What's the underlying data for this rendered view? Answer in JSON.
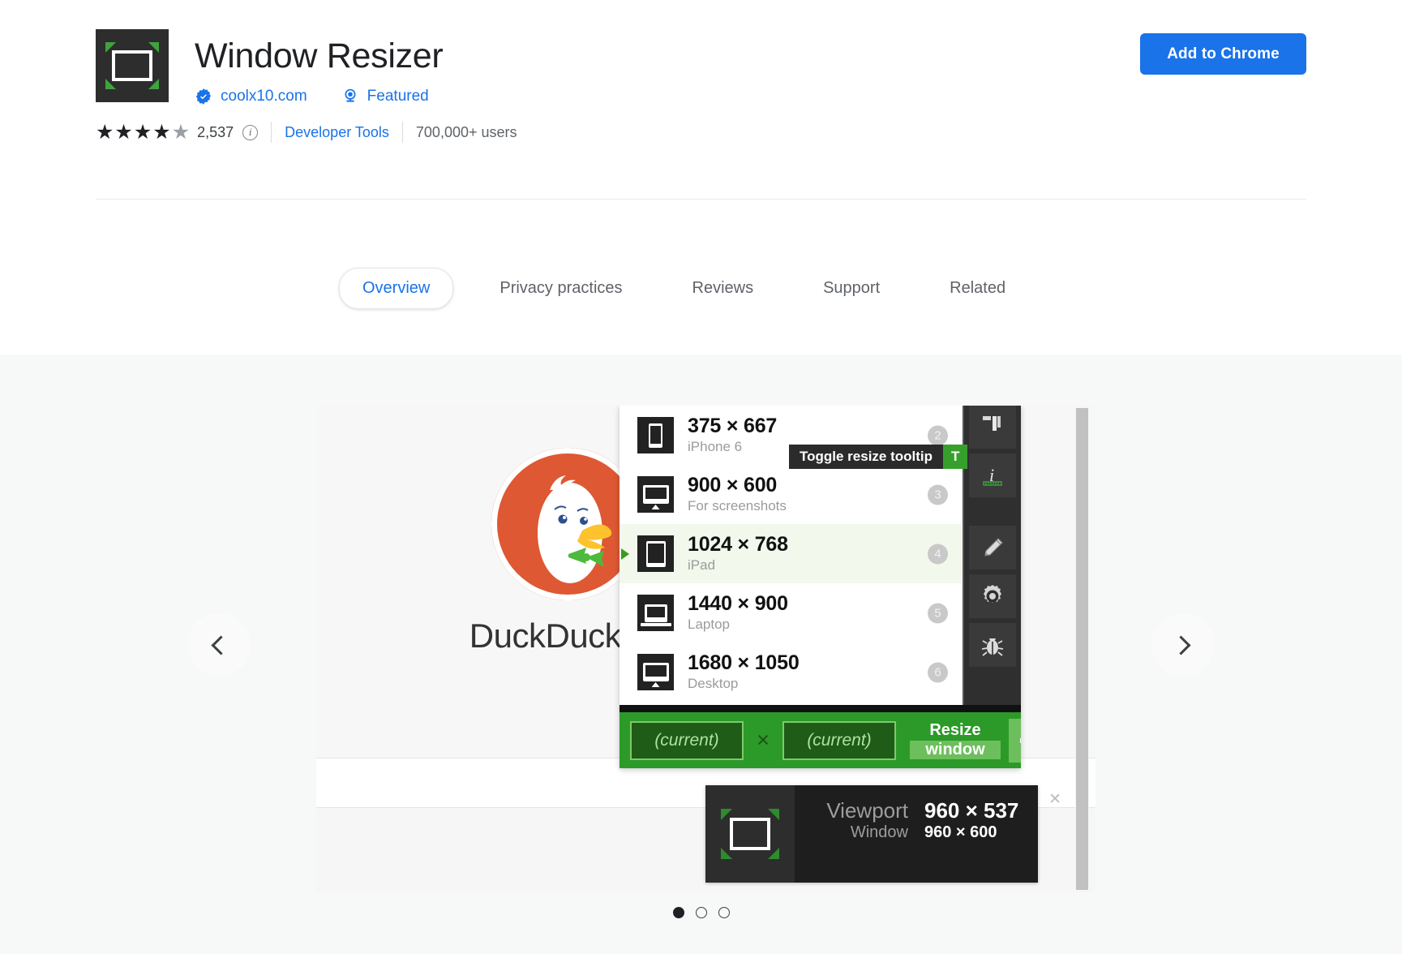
{
  "header": {
    "title": "Window Resizer",
    "icon_name": "window-resizer-logo",
    "developer": "coolx10.com",
    "featured_label": "Featured",
    "rating_count": "2,537",
    "stars_filled": 4,
    "stars_half": 1,
    "category": "Developer Tools",
    "users": "700,000+ users",
    "add_button": "Add to Chrome",
    "accent_color": "#1a73e8"
  },
  "tabs": [
    {
      "label": "Overview",
      "active": true
    },
    {
      "label": "Privacy practices",
      "active": false
    },
    {
      "label": "Reviews",
      "active": false
    },
    {
      "label": "Support",
      "active": false
    },
    {
      "label": "Related",
      "active": false
    }
  ],
  "carousel": {
    "prev_label": "Previous screenshot",
    "next_label": "Next screenshot",
    "dots": [
      {
        "active": true
      },
      {
        "active": false
      },
      {
        "active": false
      }
    ]
  },
  "screenshot": {
    "site_name": "DuckDuckGo",
    "popup": {
      "resolutions": [
        {
          "dimensions": "375 × 667",
          "label": "iPhone 6",
          "number": "2",
          "device": "phone",
          "selected": false
        },
        {
          "dimensions": "900 × 600",
          "label": "For screenshots",
          "number": "3",
          "device": "monitor",
          "selected": false
        },
        {
          "dimensions": "1024 × 768",
          "label": "iPad",
          "number": "4",
          "device": "tablet",
          "selected": true
        },
        {
          "dimensions": "1440 × 900",
          "label": "Laptop",
          "number": "5",
          "device": "laptop",
          "selected": false
        },
        {
          "dimensions": "1680 × 1050",
          "label": "Desktop",
          "number": "6",
          "device": "monitor",
          "selected": false
        }
      ],
      "tooltip": {
        "text": "Toggle resize tooltip",
        "shortcut": "T"
      },
      "toolbar_icons": [
        "ruler-icon",
        "info-ruler-icon",
        "pencil-icon",
        "gear-icon",
        "bug-icon"
      ],
      "bottom_bar": {
        "width_value": "(current)",
        "multiply_symbol": "×",
        "height_value": "(current)",
        "resize_line1": "Resize",
        "resize_line2": "window",
        "go_icon": "arrow-right-icon"
      },
      "accent_green": "#2c9a28"
    },
    "viewport_tooltip": {
      "viewport_label": "Viewport",
      "viewport_value": "960 × 537",
      "window_label": "Window",
      "window_value": "960 × 600",
      "close_icon": "close-icon"
    }
  }
}
